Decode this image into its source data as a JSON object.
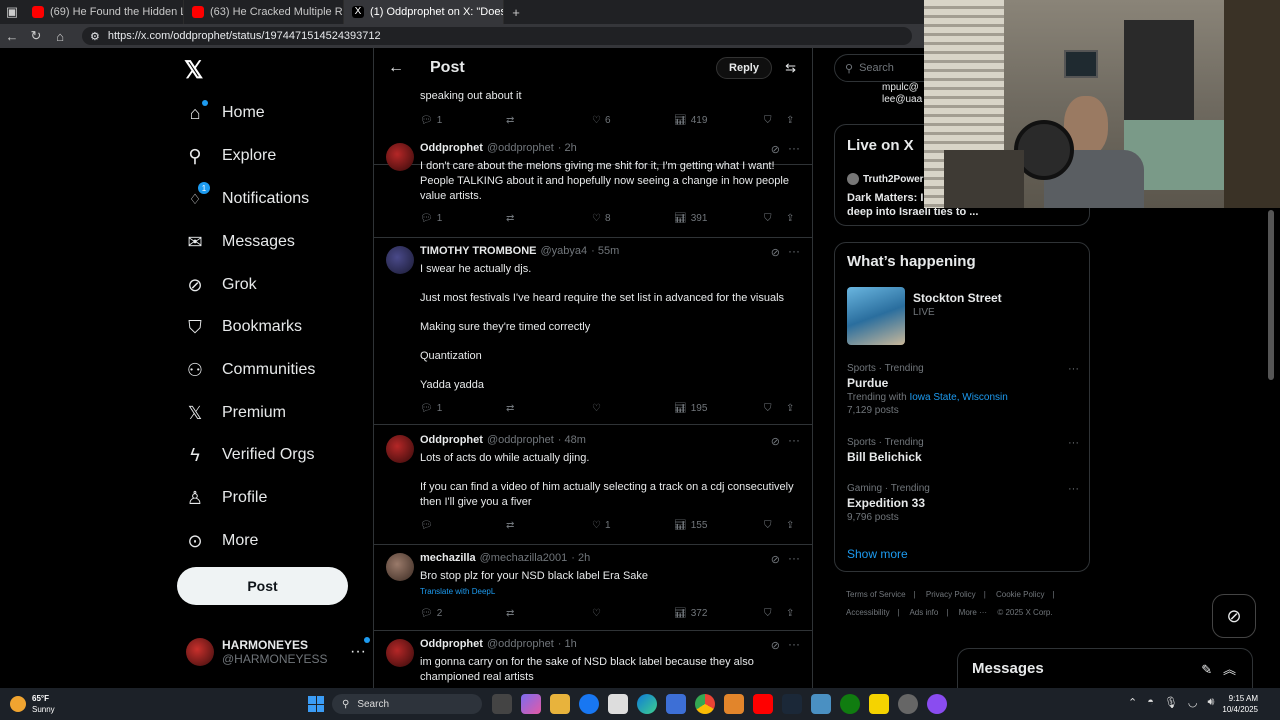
{
  "browser": {
    "tabs": [
      {
        "title": "(69) He Found the Hidden Lectur",
        "color": "#ff0000"
      },
      {
        "title": "(63) He Cracked Multiple Realitie",
        "color": "#ff0000"
      },
      {
        "title": "(1) Oddprophet on X: \"Does @dj",
        "color": "#000000"
      }
    ],
    "new_tab": "+",
    "url": "https://x.com/oddprophet/status/1974471514524393712"
  },
  "nav": {
    "logo": "𝕏",
    "items": [
      {
        "label": "Home",
        "icon": "home-icon",
        "glyph": "⌂"
      },
      {
        "label": "Explore",
        "icon": "search-icon",
        "glyph": "⚲"
      },
      {
        "label": "Notifications",
        "icon": "bell-icon",
        "glyph": "🔔"
      },
      {
        "label": "Messages",
        "icon": "envelope-icon",
        "glyph": "✉"
      },
      {
        "label": "Grok",
        "icon": "grok-icon",
        "glyph": "⊘"
      },
      {
        "label": "Bookmarks",
        "icon": "bookmark-icon",
        "glyph": "🔖"
      },
      {
        "label": "Communities",
        "icon": "people-icon",
        "glyph": "👥"
      },
      {
        "label": "Premium",
        "icon": "x-premium-icon",
        "glyph": "𝕏"
      },
      {
        "label": "Verified Orgs",
        "icon": "lightning-icon",
        "glyph": "⚡"
      },
      {
        "label": "Profile",
        "icon": "person-icon",
        "glyph": "👤"
      },
      {
        "label": "More",
        "icon": "more-circle-icon",
        "glyph": "⋯"
      }
    ],
    "notification_badge": "1",
    "post_button": "Post",
    "account": {
      "name": "HARMONEYES",
      "handle": "@HARMONEYESS",
      "more": "···"
    }
  },
  "main": {
    "header": {
      "back": "←",
      "title": "Post",
      "reply": "Reply",
      "filter": "⇆"
    },
    "tweets": [
      {
        "partial_top": "speaking out about it",
        "actions": {
          "replies": "1",
          "retweets": "",
          "likes": "6",
          "views": "419"
        }
      },
      {
        "name": "Oddprophet",
        "handle": "@oddprophet",
        "time": "· 2h",
        "text": [
          "I don't care about the melons giving me shit for it, I'm getting what I want! People TALKING about it and hopefully now seeing a change in how people value artists."
        ],
        "actions": {
          "replies": "1",
          "retweets": "",
          "likes": "8",
          "views": "391"
        }
      },
      {
        "name": "TIMOTHY TROMBONE",
        "handle": "@yabya4",
        "time": "· 55m",
        "text": [
          "I swear he actually djs.",
          "Just most festivals I've heard require the set list in advanced for the visuals",
          "Making sure they're timed correctly",
          "Quantization",
          "Yadda yadda"
        ],
        "actions": {
          "replies": "1",
          "retweets": "",
          "likes": "",
          "views": "195"
        }
      },
      {
        "name": "Oddprophet",
        "handle": "@oddprophet",
        "time": "· 48m",
        "text": [
          "Lots of acts do while actually djing.",
          "If you can find a video of him actually selecting a track on a cdj consecutively then I'll give you a fiver"
        ],
        "actions": {
          "replies": "",
          "retweets": "",
          "likes": "1",
          "views": "155"
        }
      },
      {
        "name": "mechazilla",
        "handle": "@mechazilla2001",
        "time": "· 2h",
        "text": [
          "Bro stop plz for your NSD black label Era Sake"
        ],
        "translate": "Translate with DeepL",
        "actions": {
          "replies": "2",
          "retweets": "",
          "likes": "",
          "views": "372"
        }
      },
      {
        "name": "Oddprophet",
        "handle": "@oddprophet",
        "time": "· 1h",
        "text": [
          "im gonna carry on for the sake of NSD black label because they also championed real artists"
        ]
      }
    ]
  },
  "right": {
    "search_placeholder": "Search",
    "live_partial": {
      "text1": "mpulc@",
      "text2": "lee@uaa"
    },
    "live": {
      "title": "Live on X",
      "host": "Truth2Power",
      "headline": "Dark Matters: I",
      "sub": "deep into Israeli ties to ..."
    },
    "happening": {
      "title": "What’s happening",
      "event": {
        "title": "Stockton Street",
        "status": "LIVE"
      },
      "trends": [
        {
          "cat": "Sports · Trending",
          "title": "Purdue",
          "with_label": "Trending with",
          "with_links": "Iowa State, Wisconsin",
          "posts": "7,129 posts"
        },
        {
          "cat": "Sports · Trending",
          "title": "Bill Belichick"
        },
        {
          "cat": "Gaming · Trending",
          "title": "Expedition 33",
          "posts": "9,796 posts"
        }
      ],
      "show_more": "Show more"
    },
    "footer": [
      "Terms of Service",
      "|",
      "Privacy Policy",
      "|",
      "Cookie Policy",
      "|",
      "Accessibility",
      "|",
      "Ads info",
      "|",
      "More ···",
      "© 2025 X Corp."
    ]
  },
  "messages_drawer": {
    "title": "Messages"
  },
  "taskbar": {
    "temp": "65°F",
    "condition": "Sunny",
    "search": "Search",
    "time": "9:15 AM",
    "date": "10/4/2025"
  }
}
